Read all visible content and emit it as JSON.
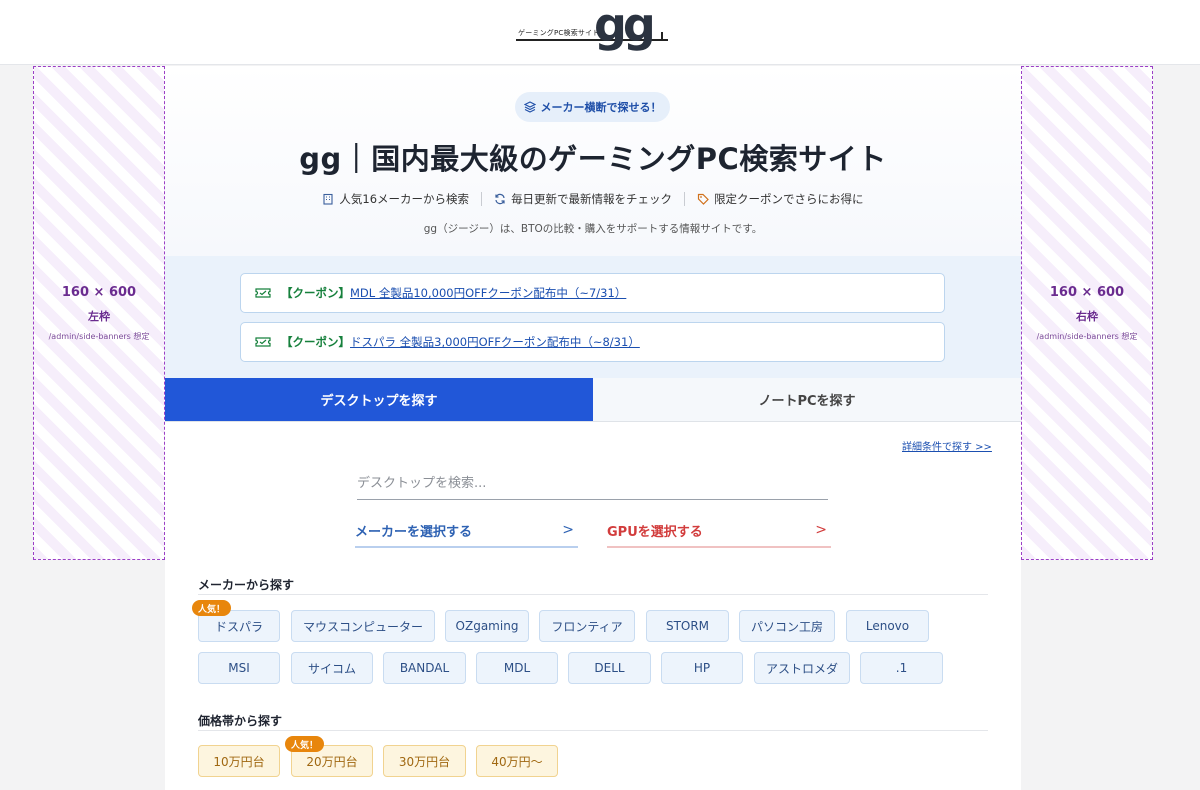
{
  "header": {
    "logo_sub": "ゲーミングPC検索サイト",
    "logo_mark": "gg"
  },
  "side_banners": {
    "left": {
      "size": "160 × 600",
      "position": "左枠",
      "note": "/admin/side-banners 想定"
    },
    "right": {
      "size": "160 × 600",
      "position": "右枠",
      "note": "/admin/side-banners 想定"
    }
  },
  "hero": {
    "pill": "メーカー横断で探せる！",
    "title": "gg｜国内最大級のゲーミングPC検索サイト",
    "features": [
      "人気16メーカーから検索",
      "毎日更新で最新情報をチェック",
      "限定クーポンでさらにお得に"
    ],
    "description": "gg（ジージー）は、BTOの比較・購入をサポートする情報サイトです。"
  },
  "coupons": [
    {
      "tag": "【クーポン】",
      "text": "MDL 全製品10,000円OFFクーポン配布中（~7/31）"
    },
    {
      "tag": "【クーポン】",
      "text": "ドスパラ 全製品3,000円OFFクーポン配布中（~8/31）"
    }
  ],
  "tabs": {
    "desktop": "デスクトップを探す",
    "notebook": "ノートPCを探す"
  },
  "detail_link": "詳細条件で探す >>",
  "search": {
    "placeholder": "デスクトップを検索..."
  },
  "selectors": {
    "maker": "メーカーを選択する",
    "gpu": "GPUを選択する",
    "arrow": ">"
  },
  "maker_section": {
    "title": "メーカーから探す",
    "popular_badge": "人気！",
    "row1": [
      "ドスパラ",
      "マウスコンピューター",
      "OZgaming",
      "フロンティア",
      "STORM",
      "パソコン工房",
      "Lenovo"
    ],
    "row2": [
      "MSI",
      "サイコム",
      "BANDAL",
      "MDL",
      "DELL",
      "HP",
      "アストロメダ",
      ".1"
    ]
  },
  "price_section": {
    "title": "価格帯から探す",
    "popular_badge": "人気！",
    "items": [
      "10万円台",
      "20万円台",
      "30万円台",
      "40万円〜"
    ]
  },
  "colors": {
    "accent_blue": "#2157d8",
    "coupon_green": "#16803c",
    "gpu_red": "#d23c3c",
    "badge_orange": "#e8860c",
    "banner_purple": "#9b3fc6"
  }
}
